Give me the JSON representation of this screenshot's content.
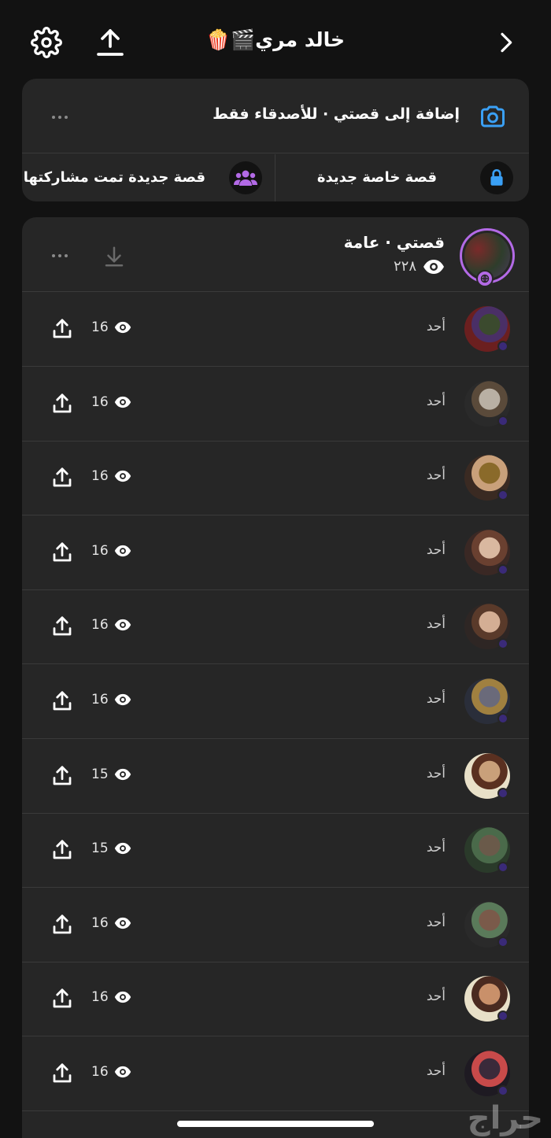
{
  "header": {
    "title": "خالد مري🎬🍿",
    "icons": {
      "back": "chevron-right-icon",
      "share": "upload-icon",
      "settings": "gear-icon"
    }
  },
  "add_story": {
    "label": "إضافة إلى قصتي · للأصدقاء فقط",
    "private_story": "قصة خاصة جديدة",
    "shared_story": "قصة جديدة تمت مشاركتها"
  },
  "my_story": {
    "title": "قصتي · عامة",
    "views": "٢٢٨"
  },
  "snaps": [
    {
      "day": "أحد",
      "views": "16",
      "colors": [
        "#6b1f1f",
        "#3b4a2e",
        "#4a2f66"
      ]
    },
    {
      "day": "أحد",
      "views": "16",
      "colors": [
        "#2a2a2a",
        "#b9b0a4",
        "#5a4a3a"
      ]
    },
    {
      "day": "أحد",
      "views": "16",
      "colors": [
        "#3a2a22",
        "#8a6a2a",
        "#c9a07a"
      ]
    },
    {
      "day": "أحد",
      "views": "16",
      "colors": [
        "#3a2824",
        "#d9b8a0",
        "#6a4030"
      ]
    },
    {
      "day": "أحد",
      "views": "16",
      "colors": [
        "#2e2624",
        "#d4ae94",
        "#5a3a2a"
      ]
    },
    {
      "day": "أحد",
      "views": "16",
      "colors": [
        "#2a2e3a",
        "#6a6a7a",
        "#a08040"
      ]
    },
    {
      "day": "أحد",
      "views": "15",
      "colors": [
        "#e8e0c8",
        "#c9a07a",
        "#5a3020"
      ]
    },
    {
      "day": "أحد",
      "views": "15",
      "colors": [
        "#2a3a2a",
        "#6a5a4a",
        "#4a6a4a"
      ]
    },
    {
      "day": "أحد",
      "views": "16",
      "colors": [
        "#2a2a2a",
        "#7a5a4a",
        "#5a7a5a"
      ]
    },
    {
      "day": "أحد",
      "views": "16",
      "colors": [
        "#e8e0c8",
        "#c9906a",
        "#4a2a20"
      ]
    },
    {
      "day": "أحد",
      "views": "16",
      "colors": [
        "#1e1a22",
        "#3a2a3a",
        "#c84a4a"
      ]
    }
  ],
  "watermark": "حراج",
  "colors": {
    "accent_blue": "#3aa0f5",
    "accent_purple": "#b36ae6",
    "card": "#262626"
  }
}
